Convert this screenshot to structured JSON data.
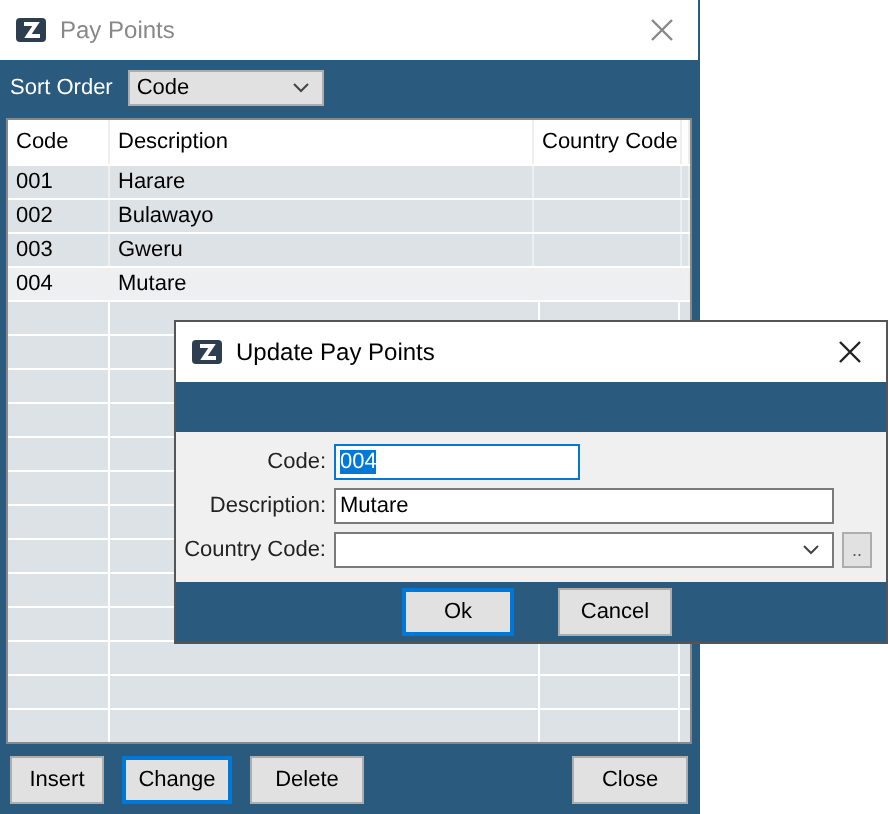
{
  "window": {
    "title": "Pay Points"
  },
  "sort_order": {
    "label": "Sort Order",
    "value": "Code"
  },
  "table": {
    "columns": [
      "Code",
      "Description",
      "Country Code"
    ],
    "rows": [
      {
        "cells": [
          "001",
          "Harare"
        ],
        "selected": false
      },
      {
        "cells": [
          "002",
          "Bulawayo"
        ],
        "selected": false
      },
      {
        "cells": [
          "003",
          "Gweru"
        ],
        "selected": false
      },
      {
        "cells": [
          "004",
          "Mutare"
        ],
        "selected": true
      }
    ]
  },
  "buttons": [
    {
      "label": "Insert",
      "focused": false
    },
    {
      "label": "Change",
      "focused": true
    },
    {
      "label": "Delete",
      "focused": false
    },
    {
      "label": "Close",
      "focused": false
    }
  ],
  "dialog": {
    "title": "Update Pay Points",
    "fields": [
      {
        "kind": "text",
        "label": "Code:",
        "value": "004",
        "text_selected": true
      },
      {
        "kind": "text",
        "label": "Description:",
        "value": "Mutare",
        "text_selected": false
      },
      {
        "kind": "combo",
        "label": "Country Code:",
        "button": ".."
      }
    ],
    "buttons": [
      {
        "label": "Ok",
        "focused": true
      },
      {
        "label": "Cancel",
        "focused": false
      }
    ]
  }
}
